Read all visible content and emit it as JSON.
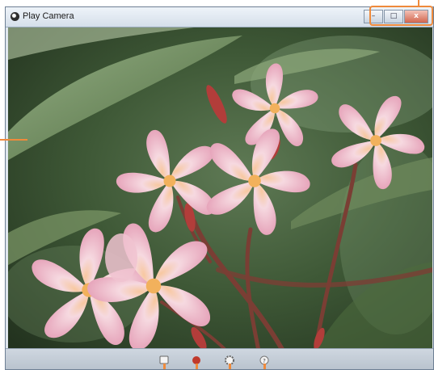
{
  "window": {
    "title": "Play Camera",
    "controls": {
      "minimize_glyph": "–",
      "maximize_glyph": "□",
      "close_glyph": "x"
    }
  },
  "toolbar": {
    "tools": [
      {
        "icon": "record-icon"
      },
      {
        "icon": "capture-icon"
      },
      {
        "icon": "settings-icon"
      },
      {
        "icon": "help-icon"
      }
    ]
  },
  "colors": {
    "callout": "#ef8a3b",
    "titlebar": "#dfe6ee",
    "close_button": "#d2654e"
  }
}
